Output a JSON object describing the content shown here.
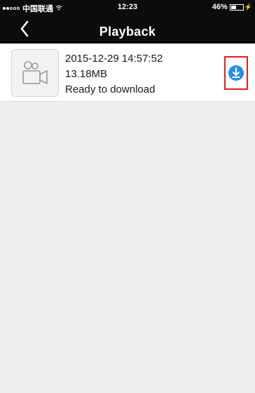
{
  "status_bar": {
    "signal_dots_filled": 2,
    "signal_dots_total": 5,
    "carrier": "中国联通",
    "wifi_icon": "wifi-icon",
    "time": "12:23",
    "battery_percent": "46%",
    "battery_level": 0.46,
    "charging_icon": "charging-bolt-icon"
  },
  "nav": {
    "back_icon": "chevron-left-icon",
    "title": "Playback"
  },
  "videos": [
    {
      "thumbnail_icon": "video-camera-icon",
      "datetime": "2015-12-29  14:57:52",
      "size": "13.18MB",
      "status": "Ready to download",
      "action_icon": "download-icon"
    }
  ],
  "colors": {
    "nav_background": "#0c0c0c",
    "page_background": "#efeff2",
    "download_accent": "#2a8ee6",
    "highlight_border": "#e51c23"
  }
}
